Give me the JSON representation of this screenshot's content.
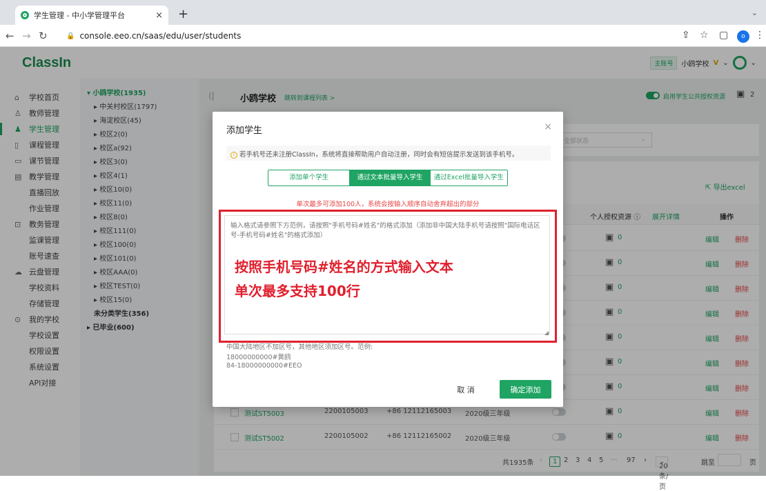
{
  "browser": {
    "tab_title": "学生管理 - 中小学管理平台",
    "url": "console.eeo.cn/saas/edu/user/students",
    "profile_initial": "o"
  },
  "app": {
    "logo": "ClassIn",
    "header": {
      "account_badge": "主账号",
      "school": "小鸥学校",
      "vip": "V"
    }
  },
  "sidebar": {
    "items": [
      {
        "label": "学校首页",
        "icon": "home-icon"
      },
      {
        "label": "教师管理",
        "icon": "user-icon"
      },
      {
        "label": "学生管理",
        "icon": "users-icon"
      },
      {
        "label": "课程管理",
        "icon": "course-icon"
      },
      {
        "label": "课节管理",
        "icon": "lesson-icon"
      },
      {
        "label": "教学管理",
        "icon": "teaching-icon"
      },
      {
        "label": "直播回放"
      },
      {
        "label": "作业管理"
      },
      {
        "label": "教务管理",
        "icon": "affairs-icon"
      },
      {
        "label": "监课管理"
      },
      {
        "label": "账号速查"
      },
      {
        "label": "云盘管理",
        "icon": "cloud-icon"
      },
      {
        "label": "学校资料"
      },
      {
        "label": "存储管理"
      },
      {
        "label": "我的学校",
        "icon": "school-icon"
      },
      {
        "label": "学校设置"
      },
      {
        "label": "权限设置"
      },
      {
        "label": "系统设置"
      },
      {
        "label": "API对接"
      }
    ]
  },
  "tree": {
    "root": "小鸥学校(1935)",
    "children": [
      "中关村校区(1797)",
      "海淀校区(45)",
      "校区2(0)",
      "校区a(92)",
      "校区3(0)",
      "校区4(1)",
      "校区10(0)",
      "校区11(0)",
      "校区8(0)",
      "校区111(0)",
      "校区100(0)",
      "校区101(0)",
      "校区AAA(0)",
      "校区TEST(0)",
      "校区15(0)"
    ],
    "unassigned": "未分类学生(356)",
    "graduated": "已毕业(600)"
  },
  "main": {
    "school_title": "小鸥学校",
    "jump_link": "跳转到课程列表 >",
    "public_toggle_label": "启用学生公共授权资源",
    "top_count": "2",
    "status_placeholder": "全部状态",
    "export_label": "导出excel",
    "columns": {
      "resource": "源 ⓘ",
      "personal": "个人授权资源 ⓘ",
      "expand": "展开详情",
      "action": "操作"
    },
    "rows": [
      {
        "name": "",
        "id": "",
        "phone": "",
        "grade": "",
        "count": "0"
      },
      {
        "name": "",
        "id": "",
        "phone": "",
        "grade": "",
        "count": "0"
      },
      {
        "name": "",
        "id": "",
        "phone": "",
        "grade": "",
        "count": "0"
      },
      {
        "name": "",
        "id": "",
        "phone": "",
        "grade": "",
        "count": "0"
      },
      {
        "name": "",
        "id": "",
        "phone": "",
        "grade": "",
        "count": "0"
      },
      {
        "name": "",
        "id": "",
        "phone": "",
        "grade": "",
        "count": "0"
      },
      {
        "name": "",
        "id": "",
        "phone": "",
        "grade": "",
        "count": "0"
      },
      {
        "name": "测试ST5003",
        "id": "2200105003",
        "phone": "+86 12112165003",
        "grade": "2020级三年级",
        "count": "0"
      },
      {
        "name": "测试ST5002",
        "id": "2200105002",
        "phone": "+86 12112165002",
        "grade": "2020级三年级",
        "count": "0"
      }
    ],
    "edit_label": "编辑",
    "delete_label": "删除",
    "pager": {
      "total": "共1935条",
      "pages": [
        "1",
        "2",
        "3",
        "4",
        "5",
        "···",
        "97"
      ],
      "page_size": "20 条/页",
      "goto": "跳至",
      "page_unit": "页"
    }
  },
  "modal": {
    "title": "添加学生",
    "notice": "若手机号还未注册ClassIn，系统将直接帮助用户自动注册，同时会有短信提示发送到该手机号。",
    "tabs": [
      "添加单个学生",
      "通过文本批量导入学生",
      "通过Excel批量导入学生"
    ],
    "selected_tab": 1,
    "limit_note": "单次最多可添加100人，系统会按输入顺序自动舍弃超出的部分",
    "textarea_placeholder": "输入格式请参照下方范例，请按照\"手机号码#姓名\"的格式添加（添加非中国大陆手机号请按照\"国际电话区号-手机号码#姓名\"的格式添加）",
    "annotation_line1": "按照手机号码#姓名的方式输入文本",
    "annotation_line2": "单次最多支持100行",
    "hint_line1": "中国大陆地区不加区号，其他地区须加区号。范例:",
    "hint_line2": "18000000000#黄鸥",
    "hint_line3": "84-18000000000#EEO",
    "cancel_label": "取 消",
    "confirm_label": "确定添加"
  },
  "colors": {
    "brand": "#1fa463",
    "danger": "#e64545",
    "annotation": "#e0202e"
  }
}
